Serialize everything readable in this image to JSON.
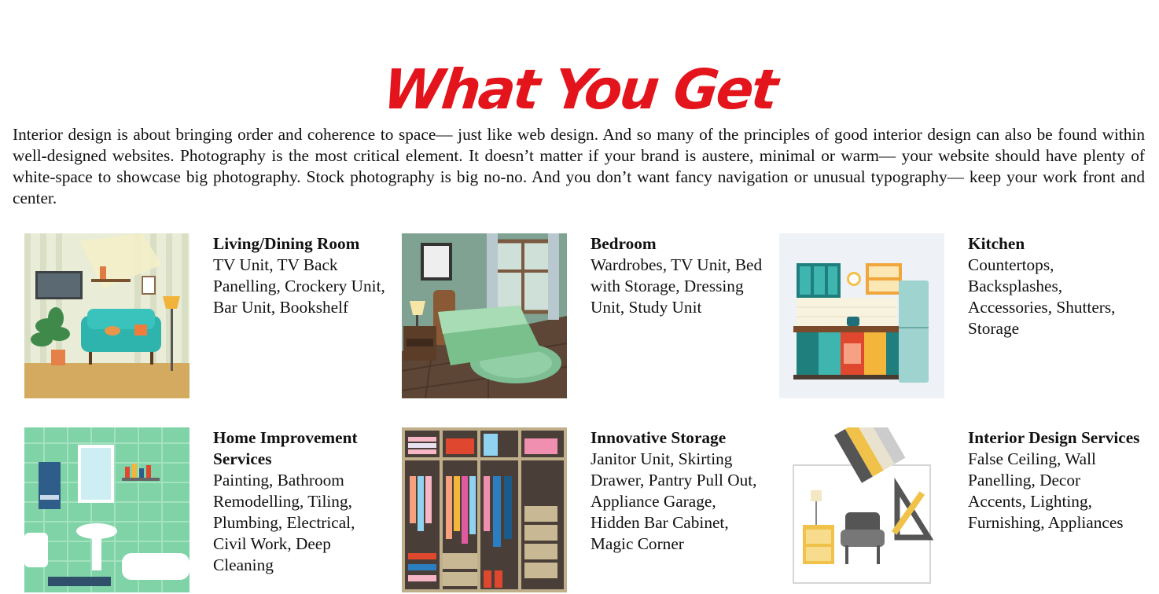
{
  "page": {
    "title": "What You Get",
    "intro": "Interior design is about bringing order and coherence to space— just like web design. And so many of the principles of good interior design can also be found within well-designed websites. Photography is the most critical element. It doesn’t matter if your brand is austere, minimal or warm— your website should have plenty of white-space to showcase big photography. Stock photography is big no-no. And you don’t want fancy navigation or unusual typography— keep your work front and center."
  },
  "services": [
    {
      "title": "Living/Dining Room",
      "desc": "TV Unit, TV Back Panelling, Crockery Unit, Bar Unit, Bookshelf",
      "icon": "living-room-illustration"
    },
    {
      "title": "Bedroom",
      "desc": "Wardrobes, TV Unit, Bed with Storage, Dressing Unit, Study Unit",
      "icon": "bedroom-illustration"
    },
    {
      "title": "Kitchen",
      "desc": "Countertops, Backsplashes, Accessories, Shutters, Storage",
      "icon": "kitchen-illustration"
    },
    {
      "title": "Home Improvement Services",
      "desc": "Painting, Bathroom Remodelling, Tiling, Plumbing, Electrical, Civil Work, Deep Cleaning",
      "icon": "bathroom-illustration"
    },
    {
      "title": "Innovative Storage",
      "desc": "Janitor Unit, Skirting Drawer, Pantry Pull Out, Appliance Garage, Hidden Bar Cabinet, Magic Corner",
      "icon": "wardrobe-illustration"
    },
    {
      "title": "Interior Design Services",
      "desc": "False Ceiling, Wall Panelling, Decor Accents, Lighting, Furnishing, Appliances",
      "icon": "design-tools-illustration"
    }
  ],
  "colors": {
    "title": "#e3141b",
    "text": "#111111",
    "background": "#ffffff"
  }
}
